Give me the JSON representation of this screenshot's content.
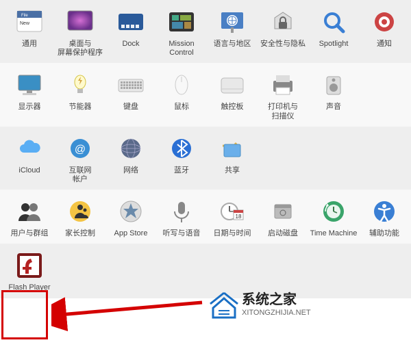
{
  "sections": [
    {
      "style": "alt",
      "items": [
        {
          "id": "general",
          "label": "通用",
          "icon": "general"
        },
        {
          "id": "desktop",
          "label": "桌面与\n屏幕保护程序",
          "icon": "desktop"
        },
        {
          "id": "dock",
          "label": "Dock",
          "icon": "dock"
        },
        {
          "id": "mission",
          "label": "Mission\nControl",
          "icon": "mission"
        },
        {
          "id": "lang",
          "label": "语言与地区",
          "icon": "lang"
        },
        {
          "id": "security",
          "label": "安全性与隐私",
          "icon": "security"
        },
        {
          "id": "spotlight",
          "label": "Spotlight",
          "icon": "spotlight"
        },
        {
          "id": "notif",
          "label": "通知",
          "icon": "notif"
        }
      ]
    },
    {
      "style": "light",
      "items": [
        {
          "id": "displays",
          "label": "显示器",
          "icon": "displays"
        },
        {
          "id": "energy",
          "label": "节能器",
          "icon": "energy"
        },
        {
          "id": "keyboard",
          "label": "键盘",
          "icon": "keyboard"
        },
        {
          "id": "mouse",
          "label": "鼠标",
          "icon": "mouse"
        },
        {
          "id": "trackpad",
          "label": "触控板",
          "icon": "trackpad"
        },
        {
          "id": "printers",
          "label": "打印机与\n扫描仪",
          "icon": "printers"
        },
        {
          "id": "sound",
          "label": "声音",
          "icon": "sound"
        }
      ]
    },
    {
      "style": "alt",
      "items": [
        {
          "id": "icloud",
          "label": "iCloud",
          "icon": "icloud"
        },
        {
          "id": "internet",
          "label": "互联网\n帐户",
          "icon": "internet"
        },
        {
          "id": "network",
          "label": "网络",
          "icon": "network"
        },
        {
          "id": "bluetooth",
          "label": "蓝牙",
          "icon": "bluetooth"
        },
        {
          "id": "sharing",
          "label": "共享",
          "icon": "sharing"
        }
      ]
    },
    {
      "style": "light",
      "items": [
        {
          "id": "users",
          "label": "用户与群组",
          "icon": "users"
        },
        {
          "id": "parental",
          "label": "家长控制",
          "icon": "parental"
        },
        {
          "id": "appstore",
          "label": "App Store",
          "icon": "appstore"
        },
        {
          "id": "dictation",
          "label": "听写与语音",
          "icon": "dictation"
        },
        {
          "id": "datetime",
          "label": "日期与时间",
          "icon": "datetime"
        },
        {
          "id": "startup",
          "label": "启动磁盘",
          "icon": "startup"
        },
        {
          "id": "timemachine",
          "label": "Time Machine",
          "icon": "timemachine"
        },
        {
          "id": "accessibility",
          "label": "辅助功能",
          "icon": "accessibility"
        }
      ]
    },
    {
      "style": "alt",
      "items": [
        {
          "id": "flash",
          "label": "Flash Player",
          "icon": "flash"
        }
      ]
    }
  ],
  "watermark": {
    "title": "系统之家",
    "url": "XITONGZHIJIA.NET"
  },
  "highlight_color": "#d40000"
}
